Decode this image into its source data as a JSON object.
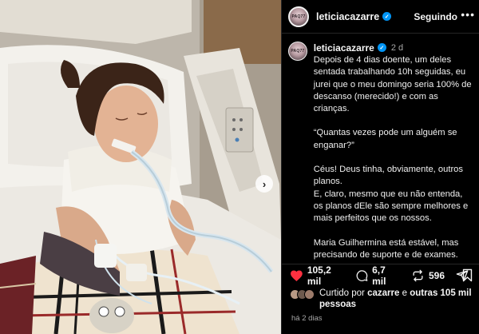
{
  "header": {
    "username": "leticiacazarre",
    "follow_label": "Seguindo",
    "more_icon": "more-horizontal-icon",
    "avatar_text": "PAQ77"
  },
  "caption": {
    "username": "leticiacazarre",
    "time": "2 d",
    "paragraphs": [
      "Depois de 4 dias doente, um deles sentada trabalhando 10h seguidas, eu jurei que o meu domingo seria 100% de descanso (merecido!) e com as crianças.",
      "“Quantas vezes pode um alguém se enganar?”",
      "Céus! Deus tinha, obviamente, outros planos.",
      "E, claro, mesmo que eu não entenda, os planos dEle são sempre melhores e mais perfeitos que os nossos.",
      "Maria Guilhermina está estável, mas precisando de suporte e de exames. Quando a gente entra no CTI, nunca"
    ]
  },
  "actions": {
    "likes_count": "105,2 mil",
    "comments_count": "6,7 mil",
    "reposts_count": "596",
    "like_icon": "heart-filled-icon",
    "comment_icon": "comment-icon",
    "repost_icon": "repost-icon",
    "share_icon": "share-icon",
    "save_icon": "bookmark-icon",
    "accent_like": "#ff3040"
  },
  "likes_summary": {
    "prefix": "Curtido por ",
    "user": "cazarre",
    "middle": " e ",
    "others": "outras 105 mil pessoas"
  },
  "date": "há 2 dias",
  "media": {
    "carousel_next_icon": "chevron-right-icon"
  }
}
